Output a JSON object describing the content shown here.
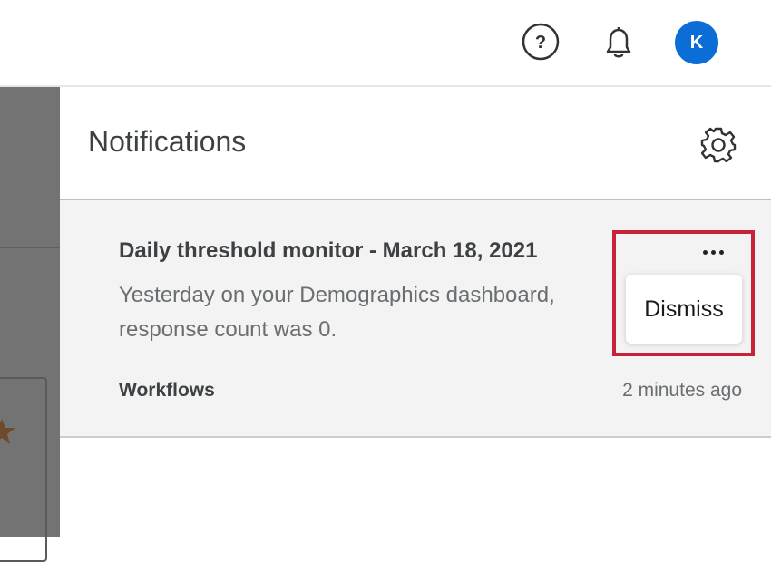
{
  "header": {
    "avatar_initial": "K",
    "help_icon": "help-circle-icon",
    "bell_icon": "bell-icon"
  },
  "panel": {
    "title": "Notifications",
    "settings_icon": "gear-icon"
  },
  "notification": {
    "title": "Daily threshold monitor - March 18, 2021",
    "body": "Yesterday on your Demographics dashboard, response count was 0.",
    "source": "Workflows",
    "time": "2 minutes ago",
    "menu": {
      "more_icon": "more-horizontal-icon",
      "dismiss_label": "Dismiss"
    }
  },
  "colors": {
    "avatar_bg": "#0b6ed6",
    "highlight": "#c8213a",
    "backdrop": "#737373"
  }
}
